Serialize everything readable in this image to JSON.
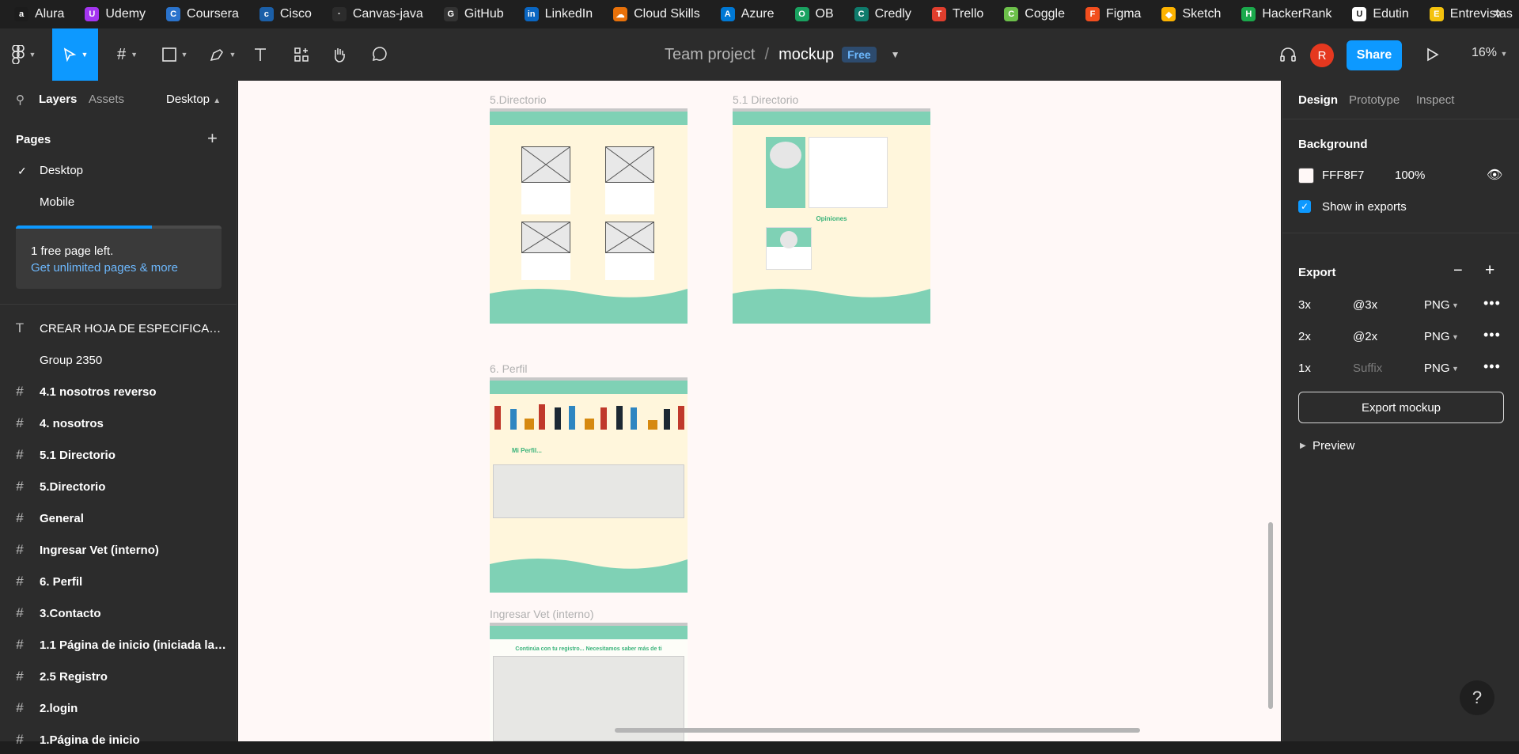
{
  "bookmarks": [
    {
      "label": "Alura",
      "icon": "alura-icon",
      "color": "#1c1c1c",
      "glyph": "a"
    },
    {
      "label": "Udemy",
      "icon": "udemy-icon",
      "color": "#a435f0",
      "glyph": "U"
    },
    {
      "label": "Coursera",
      "icon": "coursera-icon",
      "color": "#2a73cc",
      "glyph": "C"
    },
    {
      "label": "Cisco",
      "icon": "cisco-icon",
      "color": "#1b5fa8",
      "glyph": "c"
    },
    {
      "label": "Canvas-java",
      "icon": "canvas-icon",
      "color": "#2c2c2c",
      "glyph": "·"
    },
    {
      "label": "GitHub",
      "icon": "github-icon",
      "color": "#333333",
      "glyph": "G"
    },
    {
      "label": "LinkedIn",
      "icon": "linkedin-icon",
      "color": "#0a66c2",
      "glyph": "in"
    },
    {
      "label": "Cloud Skills",
      "icon": "cloud-skills-icon",
      "color": "#e8710a",
      "glyph": "☁"
    },
    {
      "label": "Azure",
      "icon": "azure-icon",
      "color": "#0078d4",
      "glyph": "A"
    },
    {
      "label": "OB",
      "icon": "ob-icon",
      "color": "#1aa260",
      "glyph": "O"
    },
    {
      "label": "Credly",
      "icon": "credly-icon",
      "color": "#0f7b6c",
      "glyph": "C"
    },
    {
      "label": "Trello",
      "icon": "trello-icon",
      "color": "#e03e2d",
      "glyph": "T"
    },
    {
      "label": "Coggle",
      "icon": "coggle-icon",
      "color": "#6cc04a",
      "glyph": "C"
    },
    {
      "label": "Figma",
      "icon": "figma-icon",
      "color": "#f24e1e",
      "glyph": "F"
    },
    {
      "label": "Sketch",
      "icon": "sketch-icon",
      "color": "#fdb300",
      "glyph": "◆"
    },
    {
      "label": "HackerRank",
      "icon": "hackerrank-icon",
      "color": "#1ba94c",
      "glyph": "H"
    },
    {
      "label": "Edutin",
      "icon": "edutin-icon",
      "color": "#ffffff",
      "glyph": "U"
    },
    {
      "label": "Entrevistas",
      "icon": "entrevistas-icon",
      "color": "#f4c20d",
      "glyph": "E"
    }
  ],
  "breadcrumb": {
    "team": "Team project",
    "separator": "/",
    "file": "mockup",
    "plan": "Free"
  },
  "toolbar": {
    "avatar_initial": "R",
    "share_label": "Share",
    "zoom": "16%"
  },
  "left_panel": {
    "tabs": {
      "layers": "Layers",
      "assets": "Assets",
      "page_selector": "Desktop"
    },
    "pages_title": "Pages",
    "pages": [
      {
        "label": "Desktop",
        "selected": true
      },
      {
        "label": "Mobile",
        "selected": false
      }
    ],
    "upsell": {
      "line1": "1 free page left.",
      "line2": "Get unlimited pages & more",
      "progress": 0.66
    },
    "layers": [
      {
        "label": "CREAR HOJA DE ESPECIFICACIO...",
        "type": "text"
      },
      {
        "label": "Group 2350",
        "type": "group"
      },
      {
        "label": "4.1 nosotros reverso",
        "type": "frame"
      },
      {
        "label": "4. nosotros",
        "type": "frame"
      },
      {
        "label": "5.1 Directorio",
        "type": "frame"
      },
      {
        "label": "5.Directorio",
        "type": "frame"
      },
      {
        "label": "General",
        "type": "frame"
      },
      {
        "label": "Ingresar Vet (interno)",
        "type": "frame"
      },
      {
        "label": "6. Perfil",
        "type": "frame"
      },
      {
        "label": "3.Contacto",
        "type": "frame"
      },
      {
        "label": "1.1 Página de inicio (iniciada la ses...",
        "type": "frame"
      },
      {
        "label": "2.5 Registro",
        "type": "frame"
      },
      {
        "label": "2.login",
        "type": "frame"
      },
      {
        "label": "1.Página de inicio",
        "type": "frame"
      }
    ]
  },
  "canvas": {
    "background": "#fff8f7",
    "frames": {
      "directorio": "5.Directorio",
      "directorio_detail": "5.1 Directorio",
      "perfil": "6. Perfil",
      "ingresar_vet": "Ingresar Vet (interno)"
    },
    "frame_texts": {
      "opiniones": "Opiniones",
      "mi_perfil": "Mi Perfil...",
      "vet_heading": "Continúa con tu registro... Necesitamos saber más de ti"
    }
  },
  "right_panel": {
    "tabs": {
      "design": "Design",
      "prototype": "Prototype",
      "inspect": "Inspect"
    },
    "background": {
      "title": "Background",
      "hex": "FFF8F7",
      "opacity": "100%",
      "show_in_exports": "Show in exports"
    },
    "export": {
      "title": "Export",
      "rows": [
        {
          "scale": "3x",
          "suffix": "@3x",
          "format": "PNG",
          "placeholder": false
        },
        {
          "scale": "2x",
          "suffix": "@2x",
          "format": "PNG",
          "placeholder": false
        },
        {
          "scale": "1x",
          "suffix": "Suffix",
          "format": "PNG",
          "placeholder": true
        }
      ],
      "button": "Export mockup",
      "preview": "Preview"
    }
  },
  "help_label": "?"
}
